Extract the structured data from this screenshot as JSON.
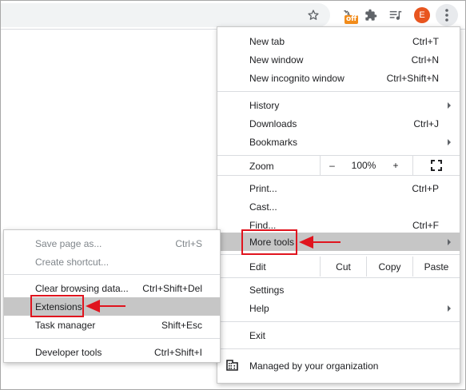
{
  "toolbar": {
    "extension_badge": "off",
    "avatar_letter": "E",
    "icons": [
      "star-icon",
      "extension-off-icon",
      "puzzle-icon",
      "media-queue-icon",
      "profile-avatar",
      "kebab-menu-icon"
    ]
  },
  "menu": {
    "new_tab": {
      "label": "New tab",
      "shortcut": "Ctrl+T"
    },
    "new_window": {
      "label": "New window",
      "shortcut": "Ctrl+N"
    },
    "new_incognito": {
      "label": "New incognito window",
      "shortcut": "Ctrl+Shift+N"
    },
    "history": {
      "label": "History"
    },
    "downloads": {
      "label": "Downloads",
      "shortcut": "Ctrl+J"
    },
    "bookmarks": {
      "label": "Bookmarks"
    },
    "zoom": {
      "label": "Zoom",
      "minus": "–",
      "value": "100%",
      "plus": "+"
    },
    "print": {
      "label": "Print...",
      "shortcut": "Ctrl+P"
    },
    "cast": {
      "label": "Cast..."
    },
    "find": {
      "label": "Find...",
      "shortcut": "Ctrl+F"
    },
    "more_tools": {
      "label": "More tools"
    },
    "edit": {
      "label": "Edit",
      "cut": "Cut",
      "copy": "Copy",
      "paste": "Paste"
    },
    "settings": {
      "label": "Settings"
    },
    "help": {
      "label": "Help"
    },
    "exit": {
      "label": "Exit"
    },
    "managed": {
      "label": "Managed by your organization"
    }
  },
  "submenu": {
    "save_page": {
      "label": "Save page as...",
      "shortcut": "Ctrl+S"
    },
    "create_shortcut": {
      "label": "Create shortcut..."
    },
    "clear_browsing": {
      "label": "Clear browsing data...",
      "shortcut": "Ctrl+Shift+Del"
    },
    "extensions": {
      "label": "Extensions"
    },
    "task_manager": {
      "label": "Task manager",
      "shortcut": "Shift+Esc"
    },
    "developer_tools": {
      "label": "Developer tools",
      "shortcut": "Ctrl+Shift+I"
    }
  },
  "colors": {
    "highlight": "#c6c6c6",
    "annotation_red": "#e0141e",
    "avatar": "#e8551f",
    "badge": "#f28c1b"
  }
}
